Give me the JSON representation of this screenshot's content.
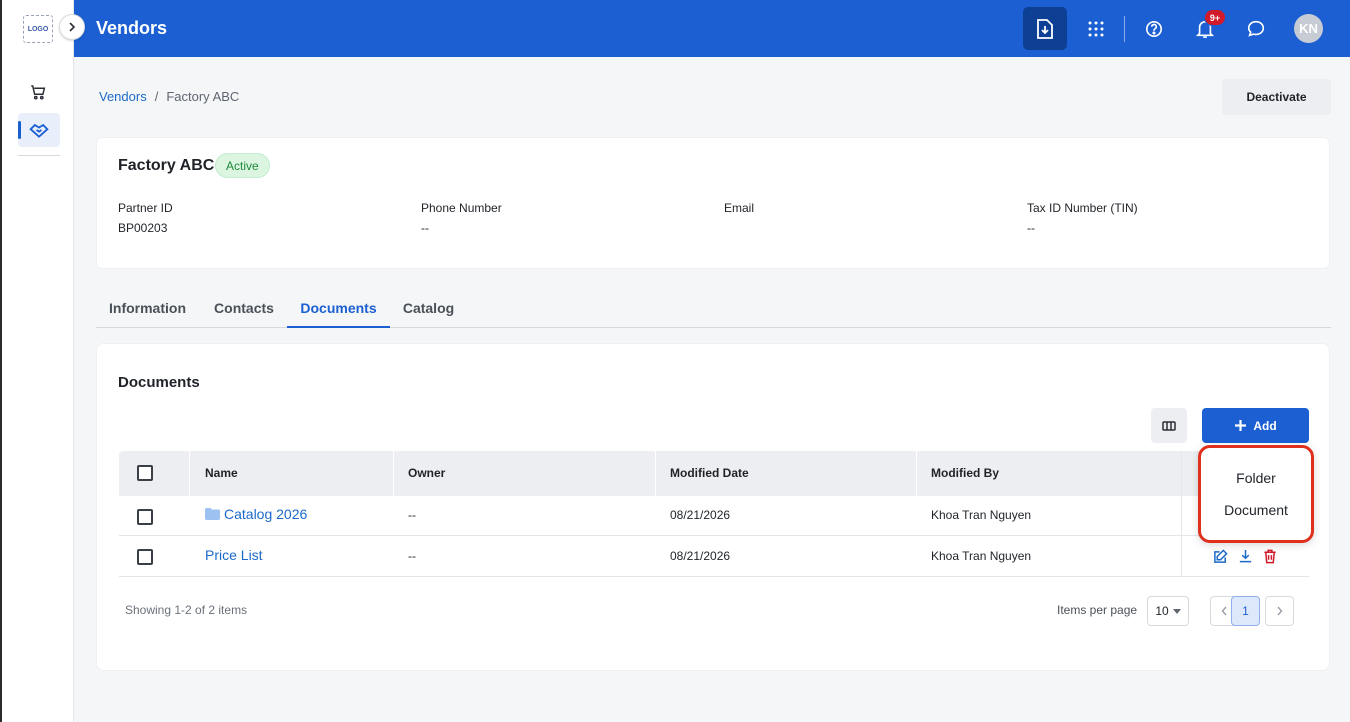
{
  "app": {
    "logo_text": "LOGO",
    "page_title": "Vendors",
    "notifications_badge": "9+",
    "avatar_initials": "KN"
  },
  "breadcrumb": {
    "parent": "Vendors",
    "separator": "/",
    "current": "Factory ABC"
  },
  "actions": {
    "deactivate_label": "Deactivate"
  },
  "vendor": {
    "name": "Factory ABC",
    "status": "Active",
    "fields": [
      {
        "label": "Partner ID",
        "value": "BP00203"
      },
      {
        "label": "Phone Number",
        "value": "--"
      },
      {
        "label": "Email",
        "value": ""
      },
      {
        "label": "Tax ID Number (TIN)",
        "value": "--"
      }
    ]
  },
  "tabs": [
    {
      "label": "Information",
      "active": false
    },
    {
      "label": "Contacts",
      "active": false
    },
    {
      "label": "Documents",
      "active": true
    },
    {
      "label": "Catalog",
      "active": false
    }
  ],
  "documents": {
    "title": "Documents",
    "add_label": "Add",
    "columns": [
      "Name",
      "Owner",
      "Modified Date",
      "Modified By"
    ],
    "rows": [
      {
        "name": "Catalog 2026",
        "type": "folder",
        "owner": "--",
        "modified_date": "08/21/2026",
        "modified_by": "Khoa Tran Nguyen"
      },
      {
        "name": "Price List",
        "type": "document",
        "owner": "--",
        "modified_date": "08/21/2026",
        "modified_by": "Khoa Tran Nguyen"
      }
    ],
    "add_menu": [
      "Folder",
      "Document"
    ]
  },
  "pagination": {
    "showing": "Showing 1-2 of 2 items",
    "items_per_page_label": "Items per page",
    "items_per_page": "10",
    "current_page": "1"
  },
  "colors": {
    "brand": "#1b5fd2",
    "active_status": "#1e8a3b",
    "danger": "#d11b2a",
    "highlight": "#e0301e"
  }
}
